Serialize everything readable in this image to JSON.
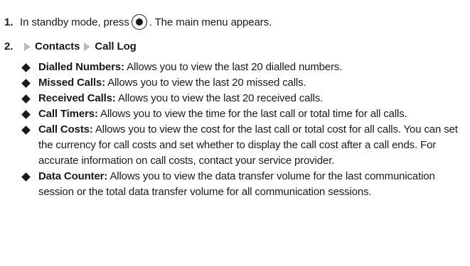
{
  "step1": {
    "number": "1.",
    "before": "In standby mode, press",
    "key_icon": "center-select-key-icon",
    "after": ". The main menu appears."
  },
  "step2": {
    "number": "2.",
    "path": [
      "Contacts",
      "Call Log"
    ]
  },
  "items": [
    {
      "term": "Dialled Numbers:",
      "desc": "Allows you to view the last 20 dialled numbers."
    },
    {
      "term": "Missed Calls:",
      "desc": "Allows you to view the last 20 missed calls."
    },
    {
      "term": "Received Calls:",
      "desc": "Allows you to view the last 20 received calls."
    },
    {
      "term": "Call Timers:",
      "desc": "Allows you to view the time for the last call or total time for all calls."
    },
    {
      "term": "Call Costs:",
      "desc": "Allows you to view the cost for the last call or total cost for all calls. You can set the currency for call costs and set whether to display the call cost after a call ends. For accurate information on call costs, contact your service provider."
    },
    {
      "term": "Data Counter:",
      "desc": "Allows you to view the data transfer volume for the last communication session or the total data transfer volume for all communication sessions."
    }
  ]
}
